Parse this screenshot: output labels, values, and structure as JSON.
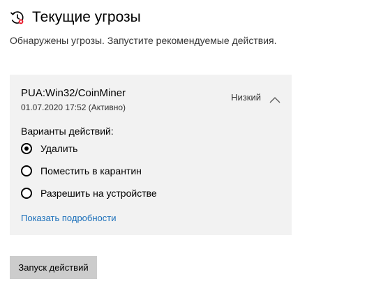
{
  "header": {
    "title": "Текущие угрозы",
    "icon": "threat-history-icon"
  },
  "subtitle": "Обнаружены угрозы. Запустите рекомендуемые действия.",
  "threat": {
    "name": "PUA:Win32/CoinMiner",
    "date_status": "01.07.2020 17:52 (Активно)",
    "severity": "Низкий",
    "expanded": true,
    "actions_label": "Варианты действий:",
    "options": [
      {
        "label": "Удалить",
        "selected": true
      },
      {
        "label": "Поместить в карантин",
        "selected": false
      },
      {
        "label": "Разрешить на устройстве",
        "selected": false
      }
    ],
    "details_link": "Показать подробности"
  },
  "start_button": "Запуск действий",
  "colors": {
    "card_background": "#f2f2f2",
    "link": "#1a6fba",
    "button_background": "#cccccc",
    "icon_alert": "#e81123"
  }
}
